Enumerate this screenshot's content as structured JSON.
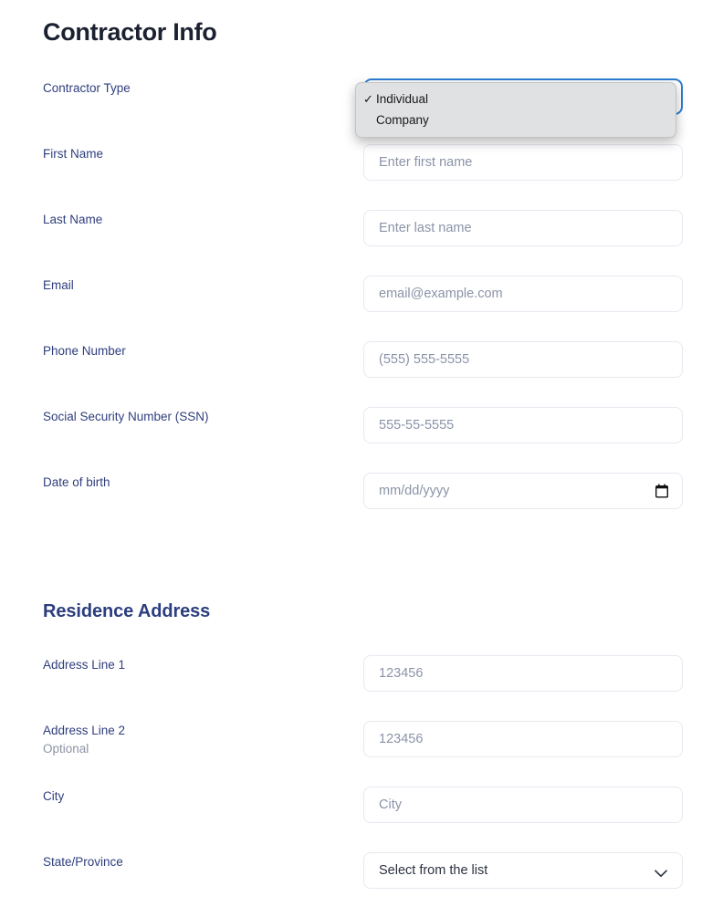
{
  "page": {
    "title": "Contractor Info"
  },
  "sections": [
    {
      "id": "contractor-info",
      "title": "Contractor Info"
    },
    {
      "id": "residence-address",
      "title": "Residence Address"
    }
  ],
  "contractor_info": {
    "contractor_type": {
      "label": "Contractor Type",
      "selected": "Individual",
      "options": [
        "Individual",
        "Company"
      ],
      "state": "open-focused",
      "focus_color": "#2d7dd2"
    },
    "first_name": {
      "label": "First Name",
      "placeholder": "Enter first name",
      "value": ""
    },
    "last_name": {
      "label": "Last Name",
      "placeholder": "Enter last name",
      "value": ""
    },
    "email": {
      "label": "Email",
      "placeholder": "email@example.com",
      "value": ""
    },
    "phone_number": {
      "label": "Phone Number",
      "placeholder": "(555) 555-5555",
      "value": ""
    },
    "ssn": {
      "label": "Social Security Number (SSN)",
      "placeholder": "555-55-5555",
      "value": ""
    },
    "date_of_birth": {
      "label": "Date of birth",
      "placeholder": "mm/dd/yyyy",
      "value": "",
      "icon": "calendar-icon"
    }
  },
  "residence_address": {
    "address_line_1": {
      "label": "Address Line 1",
      "placeholder": "123456",
      "value": ""
    },
    "address_line_2": {
      "label": "Address Line 2",
      "sublabel": "Optional",
      "placeholder": "123456",
      "value": ""
    },
    "city": {
      "label": "City",
      "placeholder": "City",
      "value": ""
    },
    "state_province": {
      "label": "State/Province",
      "selected": "Select from the list",
      "icon": "chevron-down-icon"
    }
  },
  "dropdown_popup": {
    "checkmark": "✓",
    "options": [
      {
        "label": "Individual",
        "checked": true
      },
      {
        "label": "Company",
        "checked": false
      }
    ]
  },
  "colors": {
    "title": "#1b2130",
    "section_title": "#2c3e7e",
    "label": "#2f3e7d",
    "placeholder": "#8b93a8",
    "border": "#e7e9f1",
    "focus": "#2d7dd2",
    "popup_bg": "#e0e1e2"
  }
}
